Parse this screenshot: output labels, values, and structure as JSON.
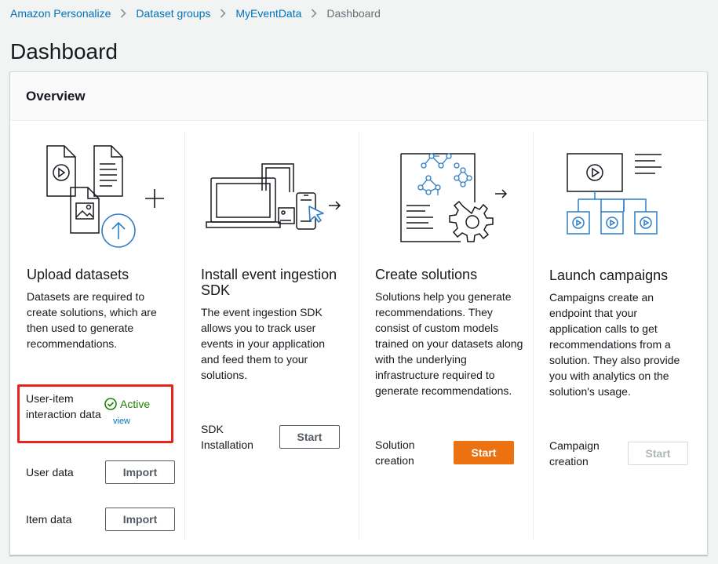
{
  "breadcrumb": {
    "items": [
      "Amazon Personalize",
      "Dataset groups",
      "MyEventData"
    ],
    "current": "Dashboard"
  },
  "page": {
    "title": "Dashboard"
  },
  "overview": {
    "header": "Overview",
    "columns": [
      {
        "title": "Upload datasets",
        "description": "Datasets are required to create solutions, which are then used to generate recommendations.",
        "rows": [
          {
            "label": "User-item interaction data",
            "status": "Active",
            "link": "view"
          },
          {
            "label": "User data",
            "button": "Import"
          },
          {
            "label": "Item data",
            "button": "Import"
          }
        ]
      },
      {
        "title": "Install event ingestion SDK",
        "description": "The event ingestion SDK allows you to track user events in your application and feed them to your solutions.",
        "row": {
          "label": "SDK Installation",
          "button": "Start"
        }
      },
      {
        "title": "Create solutions",
        "description": "Solutions help you generate recommendations. They consist of custom models trained on your datasets along with the underlying infrastructure required to generate recommendations.",
        "row": {
          "label": "Solution creation",
          "button": "Start"
        }
      },
      {
        "title": "Launch campaigns",
        "description": "Campaigns create an endpoint that your application calls to get recommendations from a solution. They also provide you with analytics on the solution's usage.",
        "row": {
          "label": "Campaign creation",
          "button": "Start"
        }
      }
    ]
  },
  "colors": {
    "link": "#0073bb",
    "primary": "#ec7211",
    "success": "#1d8102",
    "highlight": "#e8231b",
    "illustration_accent": "#2e7ec8"
  },
  "icons": [
    "chevron-right-icon",
    "check-circle-icon",
    "upload-icon",
    "play-icon",
    "cursor-icon",
    "gear-icon",
    "network-icon"
  ]
}
